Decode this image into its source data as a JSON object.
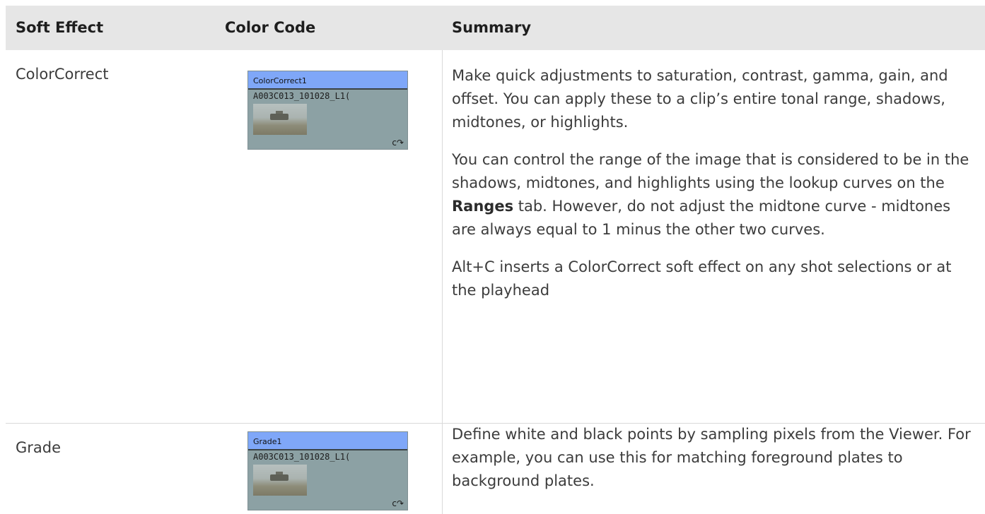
{
  "table": {
    "headers": {
      "soft_effect": "Soft Effect",
      "color_code": "Color Code",
      "summary": "Summary"
    },
    "rows": [
      {
        "name": "ColorCorrect",
        "node": {
          "title": "ColorCorrect1",
          "clip": "A003C013_101028_L1(",
          "link_icon": "clone-link-icon",
          "title_color": "#7fa7f8",
          "body_color": "#8ca1a4"
        },
        "summary": {
          "p1": "Make quick adjustments to saturation, contrast, gamma, gain, and offset. You can apply these to a clip’s entire tonal range, shadows, midtones, or highlights.",
          "p2_before": "You can control the range of the image that is considered to be in the shadows, midtones, and highlights using the lookup curves on the ",
          "p2_bold": "Ranges",
          "p2_after": " tab. However, do not adjust the midtone curve - midtones are always equal to 1 minus the other two curves.",
          "p3": "Alt+C inserts a ColorCorrect soft effect on any shot selections or at the playhead"
        }
      },
      {
        "name": "Grade",
        "node": {
          "title": "Grade1",
          "clip": "A003C013_101028_L1(",
          "link_icon": "clone-link-icon",
          "title_color": "#7fa7f8",
          "body_color": "#8ca1a4"
        },
        "summary": {
          "p1": "Define white and black points by sampling pixels from the Viewer. For example, you can use this for matching foreground plates to background plates."
        }
      }
    ]
  },
  "colors": {
    "header_bg": "#e6e6e6",
    "text": "#3c3c3c",
    "grid_line": "#d9d9d9"
  }
}
